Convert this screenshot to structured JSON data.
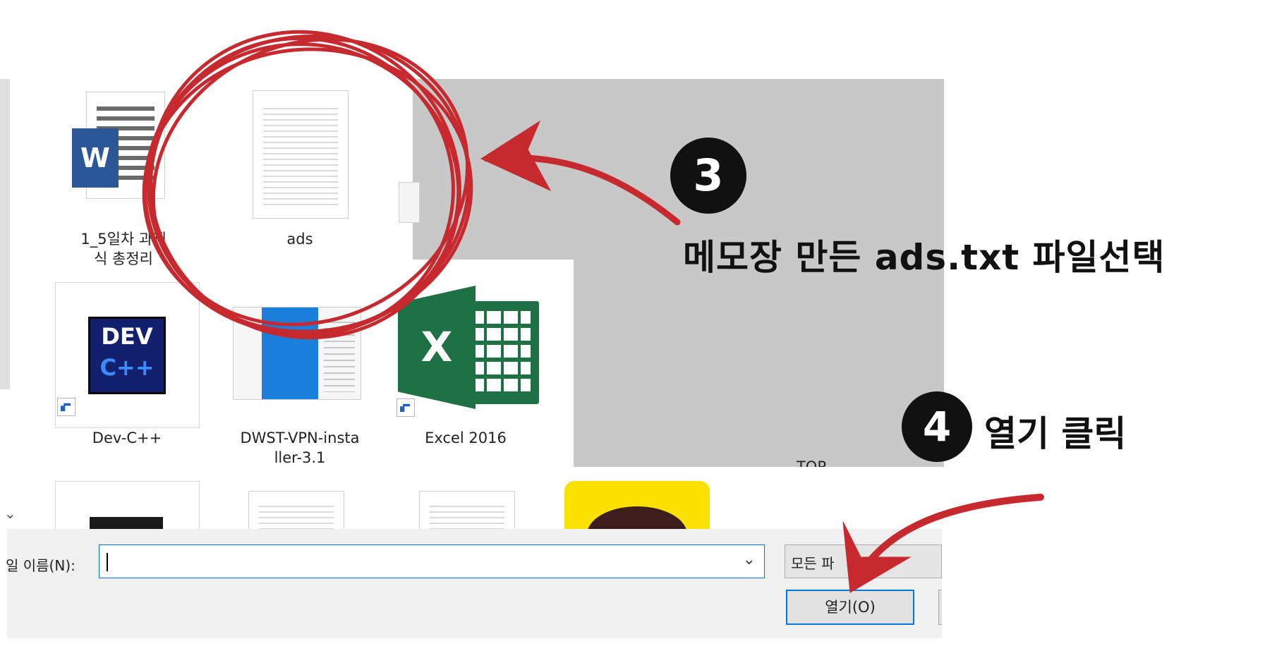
{
  "files": [
    {
      "label_line1": "1_5일차 과제",
      "label_line2": "식 총정리",
      "icon": "word-document-icon"
    },
    {
      "label_line1": "ads",
      "label_line2": "",
      "icon": "text-document-icon"
    },
    {
      "label_line1": "Dev-C++",
      "label_line2": "",
      "icon": "dev-cpp-icon"
    },
    {
      "label_line1": "DWST-VPN-insta",
      "label_line2": "ller-3.1",
      "icon": "installer-icon"
    },
    {
      "label_line1": "Excel 2016",
      "label_line2": "",
      "icon": "excel-icon"
    },
    {
      "label_line1": "TOP",
      "label_line2": "",
      "icon": "file-icon"
    }
  ],
  "icons": {
    "word_letter": "W",
    "devcpp_top": "DEV",
    "devcpp_bottom": "C++",
    "excel_letter": "X"
  },
  "dialog": {
    "filename_label": "일 이름(N):",
    "filename_value": "",
    "filetype_value": "모든 파",
    "open_button": "열기(O)"
  },
  "annotations": {
    "step3_number": "3",
    "step3_text": "메모장 만든 ads.txt 파일선택",
    "step4_number": "4",
    "step4_text": "열기 클릭"
  },
  "colors": {
    "annotation_red": "#c62a2f",
    "overlay_gray": "#c8c8c8",
    "word_blue": "#2b5797",
    "excel_green": "#1e7145",
    "open_button_border": "#0078d7"
  }
}
